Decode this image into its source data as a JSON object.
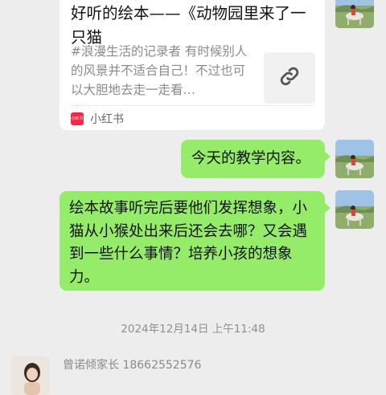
{
  "messages": {
    "link_card": {
      "title": "好听的绘本——《动物园里来了一只猫",
      "description": "#浪漫生活的记录者  有时候别人的风景并不适合自己！不过也可以大胆地去走一走看…",
      "source_logo_text": "小红书",
      "source": "小红书",
      "thumb_icon": "link-icon"
    },
    "bubble_1": "今天的教学内容。",
    "bubble_2": "绘本故事听完后要他们发挥想象，小猫从小猴处出来后还会去哪？又会遇到一些什么事情？培养小孩的想象力。",
    "timestamp": "2024年12月14日 上午11:48",
    "incoming": {
      "sender_name": "曾诺倾家长  18662552576"
    }
  },
  "colors": {
    "background": "#ededed",
    "bubble_green": "#95ec69",
    "card": "#ffffff",
    "xiaohongshu_red": "#ff2442"
  }
}
